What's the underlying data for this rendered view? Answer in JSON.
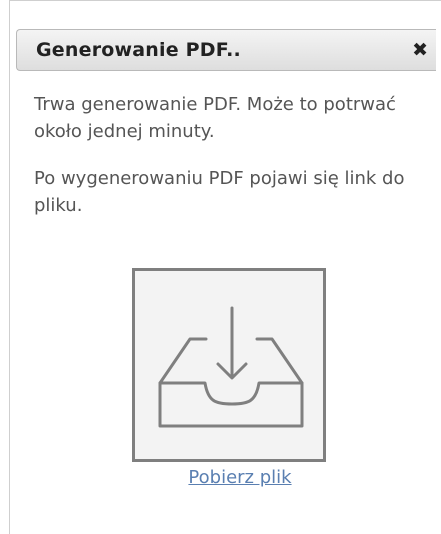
{
  "dialog": {
    "title": "Generowanie PDF..",
    "close_icon": "close-icon",
    "close_glyph": "✖",
    "message_1": "Trwa generowanie PDF. Może to potrwać około jednej minuty.",
    "message_2": "Po wygenerowaniu PDF pojawi się link do pliku.",
    "download_icon": "inbox-download-icon",
    "download_link": "Pobierz plik"
  },
  "colors": {
    "link": "#5a7fb1",
    "box_border": "#7f7f7f",
    "box_fill": "#f3f3f3"
  }
}
